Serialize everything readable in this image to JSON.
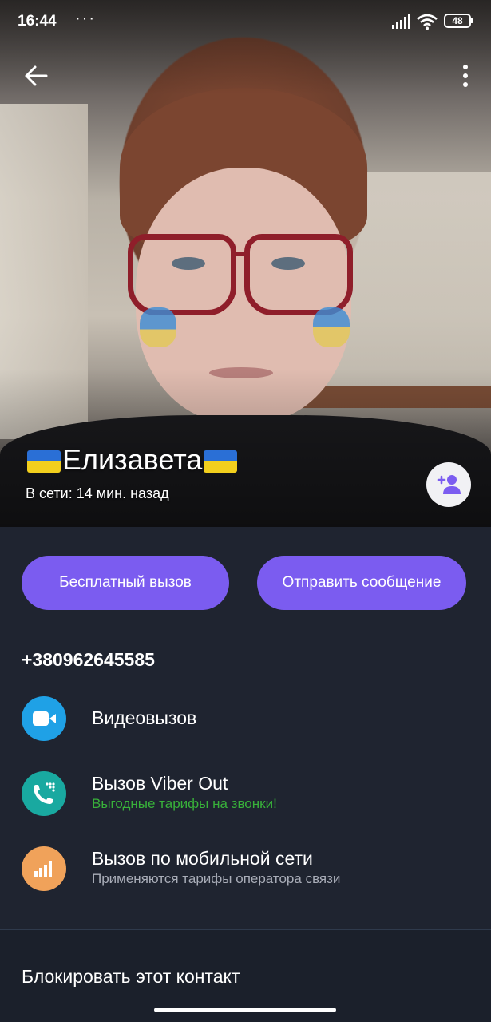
{
  "status_bar": {
    "time": "16:44",
    "dots": "···",
    "battery": "48"
  },
  "contact": {
    "name": "Елизавета",
    "last_seen": "В сети: 14 мин. назад",
    "phone": "+380962645585"
  },
  "actions": {
    "free_call": "Бесплатный вызов",
    "send_message": "Отправить сообщение"
  },
  "options": [
    {
      "title": "Видеовызов",
      "subtitle": "",
      "icon": "video-camera-icon",
      "color": "#1fa1e6"
    },
    {
      "title": "Вызов Viber Out",
      "subtitle": "Выгодные тарифы на звонки!",
      "icon": "phone-out-icon",
      "color": "#19a9a0"
    },
    {
      "title": "Вызов по мобильной сети",
      "subtitle": "Применяются тарифы оператора связи",
      "icon": "cellular-signal-icon",
      "color": "#f0a25a"
    }
  ],
  "block_contact": "Блокировать этот контакт",
  "colors": {
    "accent": "#7b5cf0",
    "background": "#1f2430",
    "viber_out_subtitle": "#38b13a"
  }
}
